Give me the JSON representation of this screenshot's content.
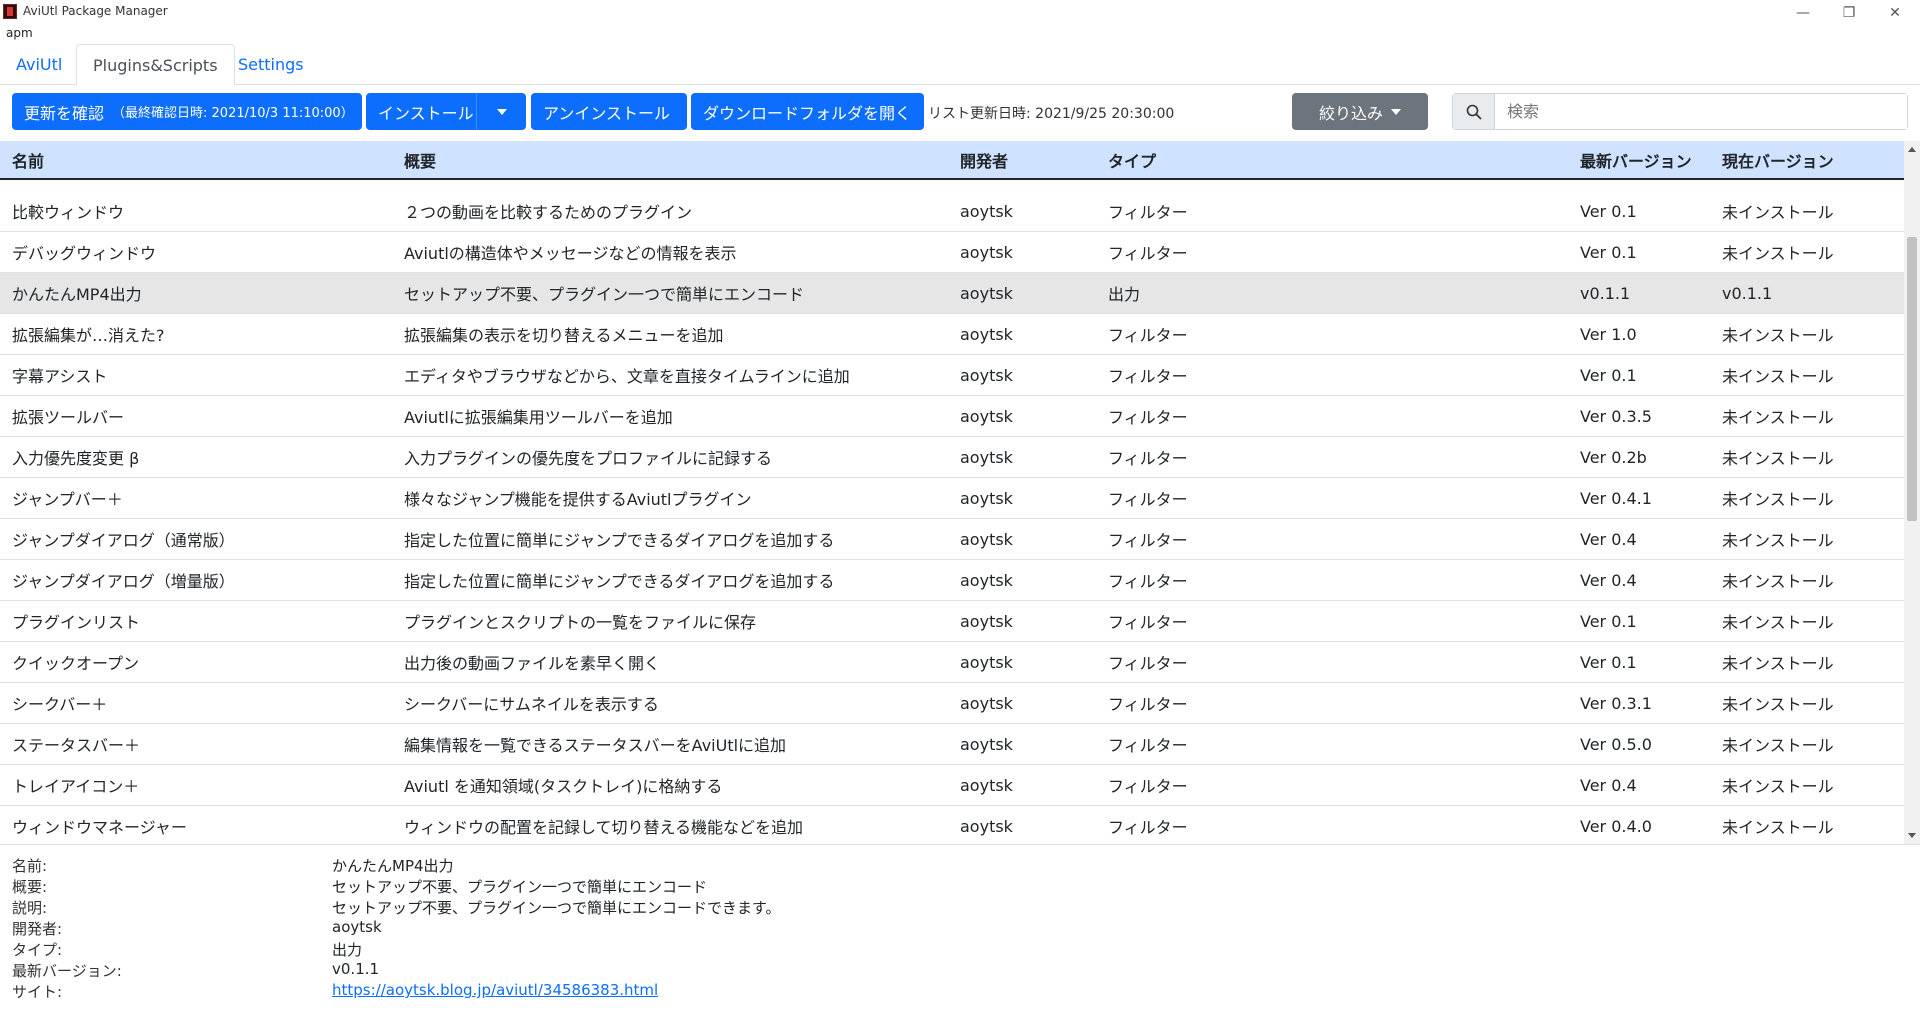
{
  "window": {
    "title": "AviUtl Package Manager",
    "minimize_glyph": "—",
    "restore_glyph": "❐",
    "close_glyph": "✕"
  },
  "menu": {
    "item": "apm"
  },
  "tabs": [
    {
      "label": "AviUtl",
      "active": false
    },
    {
      "label": "Plugins&Scripts",
      "active": true
    },
    {
      "label": "Settings",
      "active": false
    }
  ],
  "toolbar": {
    "check_update_label": "更新を確認",
    "last_checked": "（最終確認日時: 2021/10/3 11:10:00）",
    "install_label": "インストール",
    "uninstall_label": "アンインストール",
    "open_download_folder_label": "ダウンロードフォルダを開く",
    "list_updated": "リスト更新日時: 2021/9/25 20:30:00",
    "filter_label": "絞り込み",
    "search_placeholder": "検索"
  },
  "table": {
    "headers": [
      "名前",
      "概要",
      "開発者",
      "タイプ",
      "最新バージョン",
      "現在バージョン"
    ],
    "rows": [
      [
        "比較ウィンドウ",
        "２つの動画を比較するためのプラグイン",
        "aoytsk",
        "フィルター",
        "Ver 0.1",
        "未インストール"
      ],
      [
        "デバッグウィンドウ",
        "Aviutlの構造体やメッセージなどの情報を表示",
        "aoytsk",
        "フィルター",
        "Ver 0.1",
        "未インストール"
      ],
      [
        "かんたんMP4出力",
        "セットアップ不要、プラグイン一つで簡単にエンコード",
        "aoytsk",
        "出力",
        "v0.1.1",
        "v0.1.1"
      ],
      [
        "拡張編集が…消えた?",
        "拡張編集の表示を切り替えるメニューを追加",
        "aoytsk",
        "フィルター",
        "Ver 1.0",
        "未インストール"
      ],
      [
        "字幕アシスト",
        "エディタやブラウザなどから、文章を直接タイムラインに追加",
        "aoytsk",
        "フィルター",
        "Ver 0.1",
        "未インストール"
      ],
      [
        "拡張ツールバー",
        "Aviutlに拡張編集用ツールバーを追加",
        "aoytsk",
        "フィルター",
        "Ver 0.3.5",
        "未インストール"
      ],
      [
        "入力優先度変更 β",
        "入力プラグインの優先度をプロファイルに記録する",
        "aoytsk",
        "フィルター",
        "Ver 0.2b",
        "未インストール"
      ],
      [
        "ジャンプバー＋",
        "様々なジャンプ機能を提供するAviutlプラグイン",
        "aoytsk",
        "フィルター",
        "Ver 0.4.1",
        "未インストール"
      ],
      [
        "ジャンプダイアログ（通常版）",
        "指定した位置に簡単にジャンプできるダイアログを追加する",
        "aoytsk",
        "フィルター",
        "Ver 0.4",
        "未インストール"
      ],
      [
        "ジャンプダイアログ（増量版）",
        "指定した位置に簡単にジャンプできるダイアログを追加する",
        "aoytsk",
        "フィルター",
        "Ver 0.4",
        "未インストール"
      ],
      [
        "プラグインリスト",
        "プラグインとスクリプトの一覧をファイルに保存",
        "aoytsk",
        "フィルター",
        "Ver 0.1",
        "未インストール"
      ],
      [
        "クイックオープン",
        "出力後の動画ファイルを素早く開く",
        "aoytsk",
        "フィルター",
        "Ver 0.1",
        "未インストール"
      ],
      [
        "シークバー＋",
        "シークバーにサムネイルを表示する",
        "aoytsk",
        "フィルター",
        "Ver 0.3.1",
        "未インストール"
      ],
      [
        "ステータスバー＋",
        "編集情報を一覧できるステータスバーをAviUtlに追加",
        "aoytsk",
        "フィルター",
        "Ver 0.5.0",
        "未インストール"
      ],
      [
        "トレイアイコン＋",
        "Aviutl を通知領域(タスクトレイ)に格納する",
        "aoytsk",
        "フィルター",
        "Ver 0.4",
        "未インストール"
      ],
      [
        "ウィンドウマネージャー",
        "ウィンドウの配置を記録して切り替える機能などを追加",
        "aoytsk",
        "フィルター",
        "Ver 0.4.0",
        "未インストール"
      ]
    ],
    "selected_row": 2
  },
  "details": {
    "rows": [
      {
        "label": "名前:",
        "value": "かんたんMP4出力"
      },
      {
        "label": "概要:",
        "value": "セットアップ不要、プラグイン一つで簡単にエンコード"
      },
      {
        "label": "説明:",
        "value": "セットアップ不要、プラグイン一つで簡単にエンコードできます。"
      },
      {
        "label": "開発者:",
        "value": "aoytsk"
      },
      {
        "label": "タイプ:",
        "value": "出力"
      },
      {
        "label": "最新バージョン:",
        "value": "v0.1.1"
      },
      {
        "label": "サイト:",
        "value": "https://aoytsk.blog.jp/aviutl/34586383.html",
        "link": true
      }
    ]
  },
  "colors": {
    "primary": "#0d6efd",
    "secondary": "#6c757d",
    "header_bg": "#cfe2ff",
    "selected_row_bg": "#e6e6e6"
  }
}
